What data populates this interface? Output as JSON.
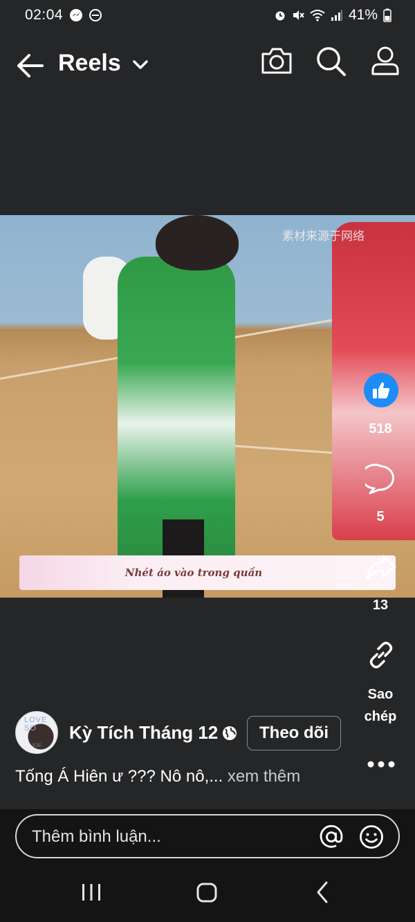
{
  "status_bar": {
    "time": "02:04",
    "battery": "41%",
    "left_icons": [
      "messenger-icon",
      "dnd-icon"
    ],
    "right_icons": [
      "alarm-icon",
      "mute-icon",
      "wifi-icon",
      "signal-icon",
      "battery-icon"
    ]
  },
  "header": {
    "title": "Reels",
    "icons": [
      "back-arrow-icon",
      "chevron-down-icon",
      "camera-icon",
      "search-icon",
      "profile-icon"
    ]
  },
  "video": {
    "watermark": "素材来源于网络",
    "caption": "Nhét áo vào trong quần"
  },
  "actions": {
    "likes": "518",
    "comments": "5",
    "shares": "13",
    "copy_label": "Sao chép"
  },
  "author": {
    "name": "Kỳ Tích Tháng 12",
    "follow_label": "Theo dõi",
    "avatar_text": "LOVE SO",
    "avatar_subtext": "KM"
  },
  "description": {
    "text": "Tống Á Hiên ư ??? Nô nô,...",
    "more": "xem thêm"
  },
  "comment": {
    "placeholder": "Thêm bình luận..."
  },
  "colors": {
    "background": "#252628",
    "like_blue": "#1d8cf8",
    "bottom_bar": "#141414"
  }
}
